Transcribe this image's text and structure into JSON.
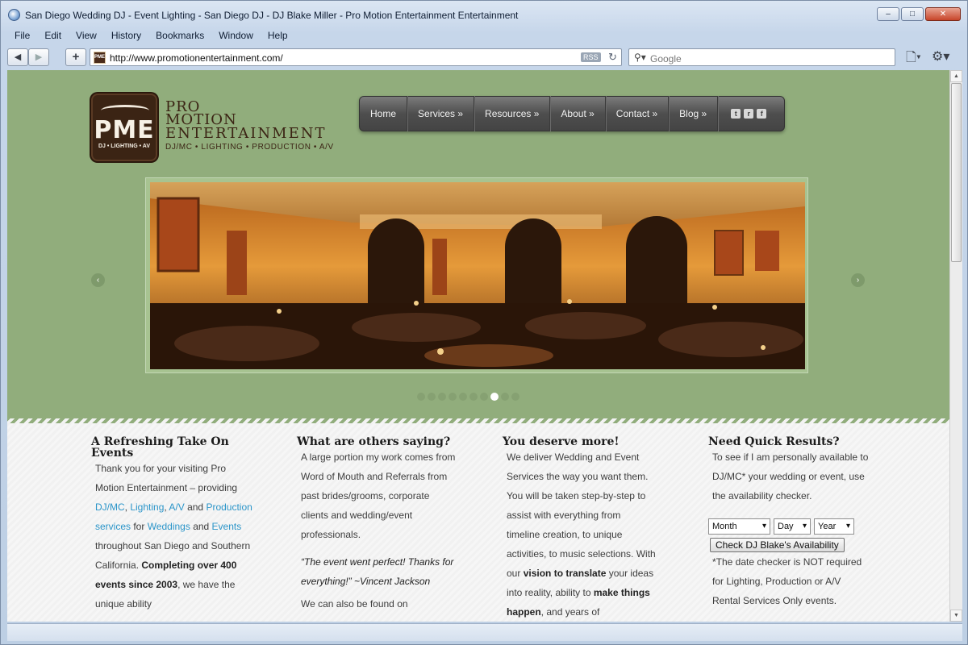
{
  "window": {
    "title": "San Diego Wedding DJ - Event Lighting - San Diego DJ - DJ Blake Miller - Pro Motion Entertainment Entertainment",
    "controls": [
      "–",
      "□",
      "✕"
    ]
  },
  "menu": [
    "File",
    "Edit",
    "View",
    "History",
    "Bookmarks",
    "Window",
    "Help"
  ],
  "toolbar": {
    "url": "http://www.promotionentertainment.com/",
    "rss": "RSS",
    "search_placeholder": "Google",
    "favicon_text": "PME"
  },
  "site": {
    "logo_mark": "PME",
    "logo_sub": "DJ • LIGHTING • AV",
    "logo_line1": "PRO",
    "logo_line2": "MOTION",
    "logo_line3": "ENTERTAINMENT",
    "logo_tagline": "DJ/MC • LIGHTING • PRODUCTION • A/V",
    "nav": [
      "Home",
      "Services »",
      "Resources »",
      "About »",
      "Contact »",
      "Blog »"
    ],
    "social": [
      "t",
      "r",
      "f"
    ],
    "slider_dots": 10,
    "slider_active_dot": 8
  },
  "columns": {
    "c1": {
      "title": "A Refreshing Take On Events",
      "t1": "Thank you for your visiting Pro Motion Entertainment – providing",
      "l1": "DJ/MC",
      "sep1": ", ",
      "l2": "Lighting",
      "sep2": ", ",
      "l3": "A/V",
      "and1": " and",
      "l4": "Production services",
      "for1": " for ",
      "l5": "Weddings",
      "and2": "and ",
      "l6": "Events",
      "t2": " throughout San Diego and Southern California.",
      "b1": "Completing over 400 events since 2003",
      "t3": ", we have the unique ability"
    },
    "c2": {
      "title": "What are others saying?",
      "t1": "A large portion my work comes from Word of Mouth and Referrals from past brides/grooms, corporate clients and wedding/event professionals.",
      "quote": "“The event went perfect! Thanks for everything!” ~Vincent Jackson",
      "t2": "We can also be found on"
    },
    "c3": {
      "title": "You deserve more!",
      "t1": "We deliver Wedding and Event Services the way you want them. You will be taken step-by-step to assist with everything from timeline creation, to unique activities, to music selections. With our ",
      "b1": "vision to translate",
      "t2": " your ideas into reality, ability to ",
      "b2": "make things happen",
      "t3": ", and years of"
    },
    "c4": {
      "title": "Need Quick Results?",
      "t1": "To see if I am personally available to DJ/MC* your wedding or event, use the availability checker.",
      "month": "Month",
      "day": "Day",
      "year": "Year",
      "button": "Check DJ Blake's Availability",
      "t2": "*The date checker is NOT required for Lighting, Production or A/V Rental Services Only events."
    }
  }
}
